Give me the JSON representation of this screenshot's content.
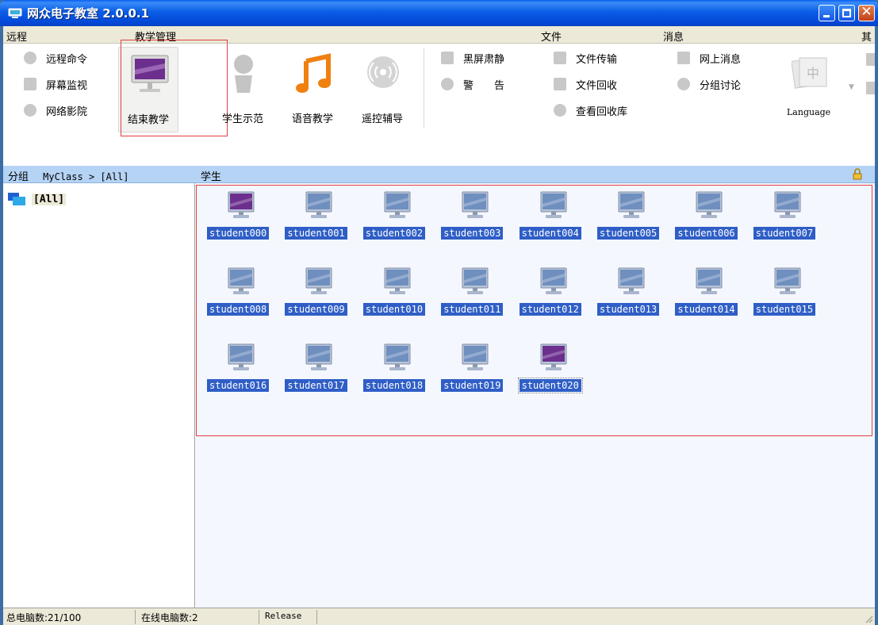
{
  "window": {
    "title": "网众电子教室 2.0.0.1"
  },
  "menu": {
    "items": [
      "远程",
      "教学管理",
      "文件",
      "消息",
      "其"
    ]
  },
  "toolbar": {
    "remote": [
      "远程命令",
      "屏幕监视",
      "网络影院"
    ],
    "teaching": [
      "结束教学",
      "学生示范",
      "语音教学",
      "遥控辅导"
    ],
    "control": [
      "黑屏肃静",
      "警　　告"
    ],
    "file": [
      "文件传输",
      "文件回收",
      "查看回收库"
    ],
    "message": [
      "网上消息",
      "分组讨论"
    ],
    "language_label": "Language",
    "language_glyph": "中"
  },
  "left_panel": {
    "header": "分组",
    "breadcrumb": "MyClass > [All]",
    "tree_item": "[All]"
  },
  "main_panel": {
    "header": "学生"
  },
  "students": [
    "student000",
    "student001",
    "student002",
    "student003",
    "student004",
    "student005",
    "student006",
    "student007",
    "student008",
    "student009",
    "student010",
    "student011",
    "student012",
    "student013",
    "student014",
    "student015",
    "student016",
    "student017",
    "student018",
    "student019",
    "student020"
  ],
  "online_students": [
    "student000",
    "student020"
  ],
  "status": {
    "total": "总电脑数:21/100",
    "online": "在线电脑数:2",
    "build": "Release"
  },
  "colors": {
    "selection": "#2f5ec6",
    "header": "#b5d3f5",
    "highlight": "#e04040",
    "online_screen": "#6c2f8e",
    "offline_screen": "#6f8fbf"
  }
}
